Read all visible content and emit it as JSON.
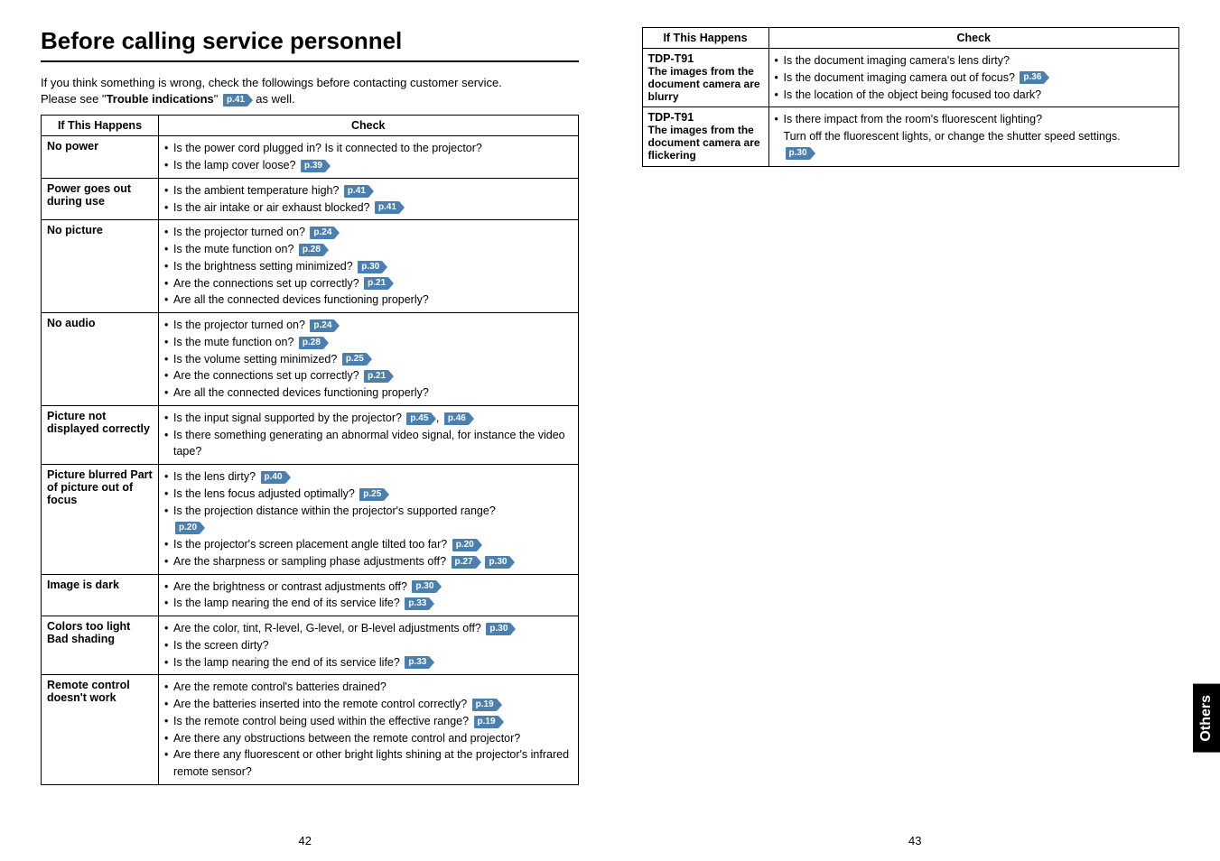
{
  "header": {
    "title": "Before calling service personnel"
  },
  "intro": {
    "line1": "If you think something is wrong, check the followings before contacting customer service.",
    "line2a": "Please see \"",
    "line2b": "Trouble indications",
    "line2c": "\" ",
    "line2d": " as well.",
    "introRef": "p.41"
  },
  "leftTable": {
    "headers": {
      "if": "If  This Happens",
      "check": "Check"
    },
    "rows": [
      {
        "symptom": "No power",
        "items": [
          {
            "text": "Is the power cord plugged in? Is it connected to the projector?"
          },
          {
            "text": "Is the lamp cover loose? ",
            "refs": [
              "p.39"
            ]
          }
        ]
      },
      {
        "symptom": "Power goes out during use",
        "items": [
          {
            "text": "Is the ambient temperature high? ",
            "refs": [
              "p.41"
            ]
          },
          {
            "text": "Is the air intake or air exhaust blocked? ",
            "refs": [
              "p.41"
            ]
          }
        ]
      },
      {
        "symptom": "No picture",
        "items": [
          {
            "text": "Is the projector turned on? ",
            "refs": [
              "p.24"
            ]
          },
          {
            "text": "Is the mute function on? ",
            "refs": [
              "p.28"
            ]
          },
          {
            "text": "Is the brightness setting minimized? ",
            "refs": [
              "p.30"
            ]
          },
          {
            "text": "Are the connections set up correctly? ",
            "refs": [
              "p.21"
            ]
          },
          {
            "text": "Are all the connected devices functioning properly?"
          }
        ]
      },
      {
        "symptom": "No audio",
        "items": [
          {
            "text": "Is the projector turned on? ",
            "refs": [
              "p.24"
            ]
          },
          {
            "text": "Is the mute function on? ",
            "refs": [
              "p.28"
            ]
          },
          {
            "text": "Is the volume setting minimized? ",
            "refs": [
              "p.25"
            ]
          },
          {
            "text": "Are the connections set up correctly? ",
            "refs": [
              "p.21"
            ]
          },
          {
            "text": "Are all the connected devices functioning properly?"
          }
        ]
      },
      {
        "symptom": "Picture not displayed correctly",
        "items": [
          {
            "text": "Is the input signal supported by the projector? ",
            "refs": [
              "p.45",
              "p.46"
            ],
            "sep": " , "
          },
          {
            "text": "Is there something generating an abnormal video signal, for instance the video tape?"
          }
        ]
      },
      {
        "symptom": "Picture blurred Part of picture out of focus",
        "items": [
          {
            "text": "Is the lens dirty? ",
            "refs": [
              "p.40"
            ]
          },
          {
            "text": "Is the lens focus adjusted optimally? ",
            "refs": [
              "p.25"
            ]
          },
          {
            "text": "Is the projection distance within the projector's supported range? ",
            "refs": [
              "p.20"
            ],
            "wrapRef": true
          },
          {
            "text": "Is the projector's screen placement angle tilted too far?  ",
            "refs": [
              "p.20"
            ]
          },
          {
            "text": "Are the sharpness or sampling phase adjustments off? ",
            "refs": [
              "p.27",
              "p.30"
            ]
          }
        ]
      },
      {
        "symptom": "Image is dark",
        "items": [
          {
            "text": "Are the brightness or contrast adjustments off? ",
            "refs": [
              "p.30"
            ]
          },
          {
            "text": "Is the lamp nearing the end of its service life? ",
            "refs": [
              "p.33"
            ]
          }
        ]
      },
      {
        "symptom": "Colors too light Bad shading",
        "items": [
          {
            "text": "Are the color, tint, R-level, G-level, or B-level adjustments off? ",
            "refs": [
              "p.30"
            ]
          },
          {
            "text": "Is the screen dirty?"
          },
          {
            "text": "Is the lamp nearing the end of its service life? ",
            "refs": [
              "p.33"
            ]
          }
        ]
      },
      {
        "symptom": "Remote control doesn't work",
        "items": [
          {
            "text": "Are the remote control's batteries drained?"
          },
          {
            "text": "Are the batteries inserted into the remote control correctly? ",
            "refs": [
              "p.19"
            ]
          },
          {
            "text": "Is the remote control being used within the effective range? ",
            "refs": [
              "p.19"
            ]
          },
          {
            "text": "Are there any obstructions between the remote control and projector?"
          },
          {
            "text": "Are there any fluorescent or other bright lights shining at the projector's infrared remote sensor?"
          }
        ]
      }
    ]
  },
  "rightTable": {
    "headers": {
      "if": "If  This Happens",
      "check": "Check"
    },
    "rows": [
      {
        "symptom": "TDP-T91\nThe images from the document camera are blurry",
        "items": [
          {
            "text": "Is the document imaging camera's lens dirty?"
          },
          {
            "text": "Is the document imaging camera out of focus? ",
            "refs": [
              "p.36"
            ]
          },
          {
            "text": "Is the location of the object being focused too dark?"
          }
        ]
      },
      {
        "symptom": "TDP-T91\nThe images from the document camera are flickering",
        "items": [
          {
            "text": "Is there impact from the room's fluorescent lighting?",
            "note": "Turn off the fluorescent lights, or change the shutter speed settings. ",
            "refs": [
              "p.30"
            ],
            "wrapRef": true
          }
        ]
      }
    ]
  },
  "footer": {
    "leftPage": "42",
    "rightPage": "43",
    "sideTab": "Others"
  }
}
